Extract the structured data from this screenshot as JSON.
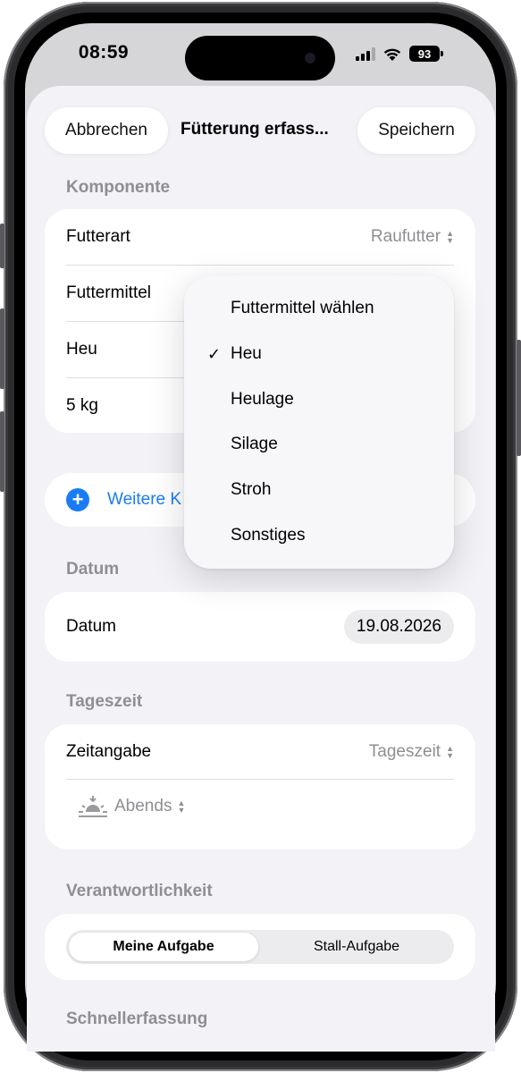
{
  "status_bar": {
    "time": "08:59",
    "battery": "93"
  },
  "nav": {
    "cancel_label": "Abbrechen",
    "title": "Fütterung erfass...",
    "save_label": "Speichern"
  },
  "komponente": {
    "section_label": "Komponente",
    "futterart_label": "Futterart",
    "futterart_value": "Raufutter",
    "futtermittel_label": "Futtermittel",
    "selected_value": "Heu",
    "amount": "5 kg"
  },
  "add_component": {
    "label": "Weitere K"
  },
  "datum": {
    "section_label": "Datum",
    "label": "Datum",
    "value": "19.08.2026"
  },
  "tageszeit": {
    "section_label": "Tageszeit",
    "label": "Zeitangabe",
    "value": "Tageszeit",
    "time_of_day": "Abends",
    "icon": "sunset-icon"
  },
  "verantwortlichkeit": {
    "section_label": "Verantwortlichkeit",
    "options": [
      "Meine Aufgabe",
      "Stall-Aufgabe"
    ],
    "selected": "Meine Aufgabe"
  },
  "schnellerfassung": {
    "section_label": "Schnellerfassung"
  },
  "menu": {
    "items": [
      "Futtermittel wählen",
      "Heu",
      "Heulage",
      "Silage",
      "Stroh",
      "Sonstiges"
    ],
    "checked": "Heu"
  },
  "colors": {
    "accent": "#1a7cf5",
    "background": "#f2f2f7",
    "secondary_text": "#8e8e93"
  }
}
